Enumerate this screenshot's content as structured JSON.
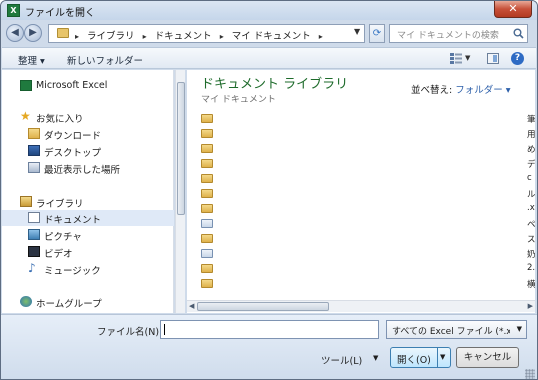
{
  "window": {
    "title": "ファイルを開く",
    "app_icon_letter": "X",
    "close_glyph": "✕"
  },
  "address": {
    "crumbs": [
      "ライブラリ",
      "ドキュメント",
      "マイ ドキュメント"
    ],
    "separator": "▸",
    "search_placeholder": "マイ ドキュメントの検索"
  },
  "toolbar": {
    "organize": "整理 ▾",
    "new_folder": "新しいフォルダー"
  },
  "navpane": {
    "items": [
      {
        "label": "Microsoft Excel",
        "icon": "excel-icon"
      },
      {
        "label": "お気に入り",
        "icon": "star-icon"
      },
      {
        "label": "ダウンロード",
        "icon": "download-folder-icon"
      },
      {
        "label": "デスクトップ",
        "icon": "desktop-icon"
      },
      {
        "label": "最近表示した場所",
        "icon": "recent-places-icon"
      },
      {
        "label": "ライブラリ",
        "icon": "library-icon"
      },
      {
        "label": "ドキュメント",
        "icon": "documents-icon",
        "selected": true
      },
      {
        "label": "ピクチャ",
        "icon": "pictures-icon"
      },
      {
        "label": "ビデオ",
        "icon": "videos-icon"
      },
      {
        "label": "ミュージック",
        "icon": "music-icon"
      },
      {
        "label": "ホームグループ",
        "icon": "homegroup-icon"
      }
    ]
  },
  "content": {
    "library_title": "ドキュメント ライブラリ",
    "library_subtitle": "マイ ドキュメント",
    "arrange_label": "並べ替え:",
    "arrange_value": "フォルダー ▾",
    "files": [
      "筆",
      "用",
      "め",
      "デ",
      "c",
      "ル",
      ".x",
      "ペ",
      "ス",
      "奶",
      "2.",
      "横"
    ]
  },
  "bottom": {
    "filename_label": "ファイル名(N):",
    "filename_value": "",
    "filetype_value": "すべての Excel ファイル (*.xl",
    "tools_label": "ツール(L)",
    "open_label": "開く(O)",
    "cancel_label": "キャンセル"
  }
}
